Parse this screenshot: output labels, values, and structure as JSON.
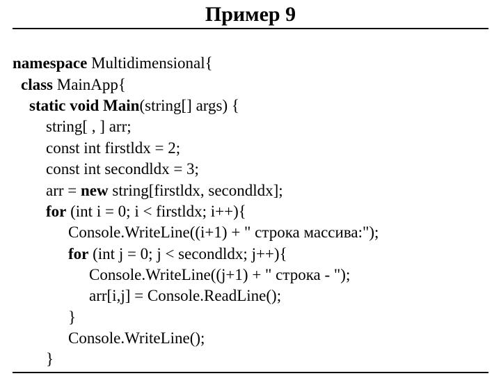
{
  "title": "Пример 9",
  "kw": {
    "namespace": "namespace",
    "class": "class",
    "static": "static",
    "void_main": "void Main",
    "new": "new",
    "for": "for"
  },
  "code": {
    "l01b": " Multidimensional{",
    "l02b": " MainApp{",
    "l03a": " ",
    "l03b": "(string[] args) {",
    "l04": "string[ , ] arr;",
    "l05": "const int firstldx = 2;",
    "l06": "const int secondldx = 3;",
    "l07a": "arr = ",
    "l07b": " string[firstldx, secondldx];",
    "l08a": " (int i = 0; i < firstldx; i++){",
    "l09": "Console.WriteLine((i+1) + \" строка массива:\");",
    "l10a": " (int j = 0; j < secondldx; j++){",
    "l11": "Console.WriteLine((j+1) + \" строка - \");",
    "l12": "arr[i,j] = Console.ReadLine();",
    "l13": "}",
    "l14": "Console.WriteLine();",
    "l15": "}"
  }
}
